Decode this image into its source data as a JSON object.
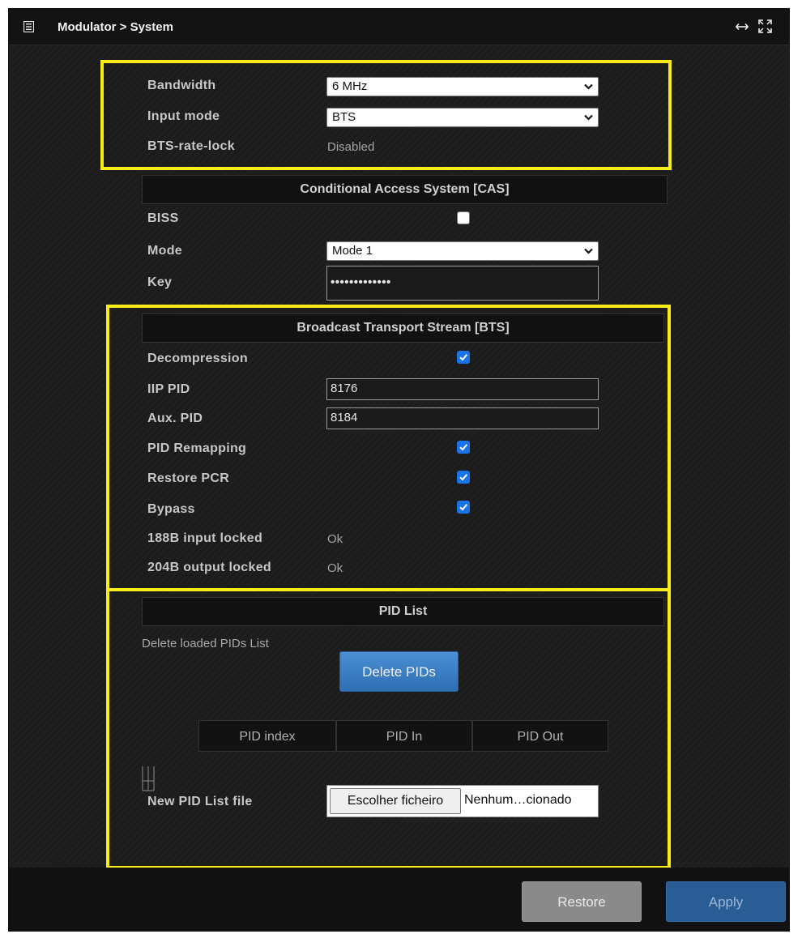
{
  "window": {
    "title": "Modulator > System",
    "icons": {
      "title": "list-icon",
      "resize": "horizontal-resize-icon",
      "fullscreen": "fullscreen-icon"
    }
  },
  "general": {
    "bandwidth": {
      "label": "Bandwidth",
      "value": "6 MHz"
    },
    "input_mode": {
      "label": "Input mode",
      "value": "BTS"
    },
    "bts_rate_lock": {
      "label": "BTS-rate-lock",
      "value": "Disabled"
    }
  },
  "cas": {
    "title": "Conditional Access System [CAS]",
    "biss": {
      "label": "BISS",
      "checked": false
    },
    "mode": {
      "label": "Mode",
      "value": "Mode 1"
    },
    "key": {
      "label": "Key",
      "value": "•••••••••••••"
    }
  },
  "bts": {
    "title": "Broadcast Transport Stream [BTS]",
    "decompression": {
      "label": "Decompression",
      "checked": true
    },
    "iip_pid": {
      "label": "IIP PID",
      "value": "8176"
    },
    "aux_pid": {
      "label": "Aux. PID",
      "value": "8184"
    },
    "pid_remapping": {
      "label": "PID Remapping",
      "checked": true
    },
    "restore_pcr": {
      "label": "Restore PCR",
      "checked": true
    },
    "bypass": {
      "label": "Bypass",
      "checked": true
    },
    "input_locked": {
      "label": "188B input locked",
      "value": "Ok"
    },
    "output_locked": {
      "label": "204B output locked",
      "value": "Ok"
    }
  },
  "pid_list": {
    "title": "PID List",
    "delete_text": "Delete loaded PIDs List",
    "delete_button": "Delete PIDs",
    "columns": [
      "PID index",
      "PID In",
      "PID Out"
    ],
    "new_file_label": "New PID List file",
    "choose_file_button": "Escolher ficheiro",
    "file_status": "Nenhum…cionado"
  },
  "footer": {
    "restore": "Restore",
    "apply": "Apply"
  },
  "colors": {
    "highlight": "#f7ee19",
    "checkbox_on": "#1a73e8",
    "primary_button": "#2f6fb3"
  }
}
